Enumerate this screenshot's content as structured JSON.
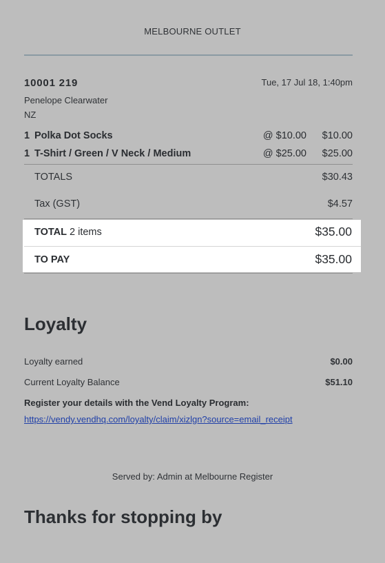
{
  "outlet_name": "MELBOURNE OUTLET",
  "receipt": {
    "number": "10001 219",
    "date": "Tue, 17 Jul 18, 1:40pm",
    "customer_name": "Penelope Clearwater",
    "customer_country": "NZ"
  },
  "line_items": [
    {
      "qty": "1",
      "name": "Polka Dot Socks",
      "unit_price": "@ $10.00",
      "amount": "$10.00"
    },
    {
      "qty": "1",
      "name": "T-Shirt / Green / V Neck / Medium",
      "unit_price": "@ $25.00",
      "amount": "$25.00"
    }
  ],
  "totals": {
    "label": "TOTALS",
    "value": "$30.43"
  },
  "tax": {
    "label": "Tax (GST)",
    "value": "$4.57"
  },
  "total": {
    "label": "TOTAL",
    "items": "2 items",
    "value": "$35.00"
  },
  "to_pay": {
    "label": "TO PAY",
    "value": "$35.00"
  },
  "loyalty": {
    "title": "Loyalty",
    "earned_label": "Loyalty earned",
    "earned_value": "$0.00",
    "balance_label": "Current Loyalty Balance",
    "balance_value": "$51.10",
    "register_text": "Register your details with the Vend Loyalty Program:",
    "link": "https://vendy.vendhq.com/loyalty/claim/xizlgn?source=email_receipt"
  },
  "served_by": "Served by: Admin at Melbourne Register",
  "thanks": "Thanks for stopping by"
}
